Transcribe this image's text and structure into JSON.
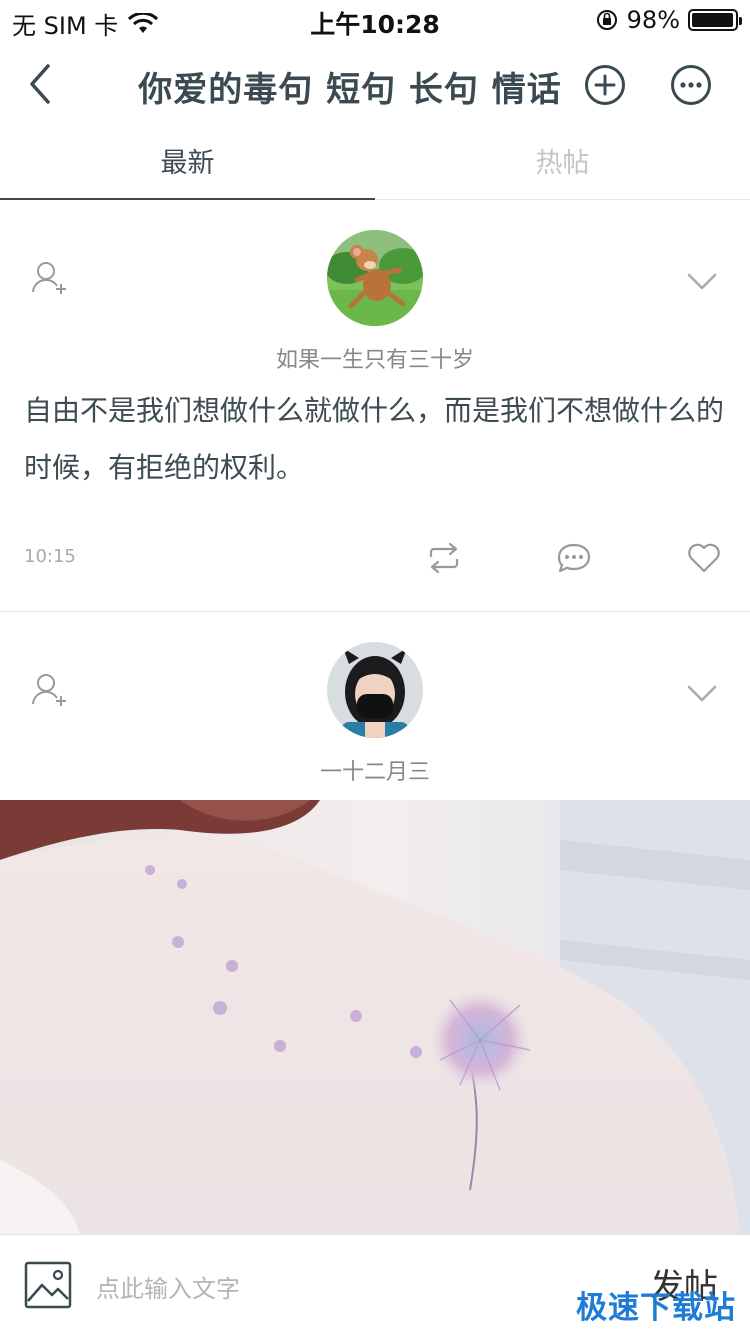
{
  "status_bar": {
    "carrier": "无 SIM 卡",
    "time": "上午10:28",
    "battery_percent": "98%",
    "battery_level": 0.98
  },
  "nav": {
    "title": "你爱的毒句 短句 长句 情话",
    "back_icon": "chevron-left-icon",
    "add_icon": "plus-circle-icon",
    "more_icon": "more-circle-icon"
  },
  "tabs": [
    {
      "label": "最新",
      "active": true
    },
    {
      "label": "热帖",
      "active": false
    }
  ],
  "posts": [
    {
      "username": "如果一生只有三十岁",
      "text": "自由不是我们想做什么就做什么，而是我们不想做什么的时候，有拒绝的权利。",
      "time": "10:15"
    },
    {
      "username": "一十二月三"
    }
  ],
  "composer": {
    "placeholder": "点此输入文字",
    "send_label": "发帖"
  },
  "watermark": "极速下载站",
  "colors": {
    "title": "#3a4a50",
    "accent_dark": "#3d4b52",
    "muted": "#aaaaaa",
    "watermark": "#1e7bd6"
  }
}
